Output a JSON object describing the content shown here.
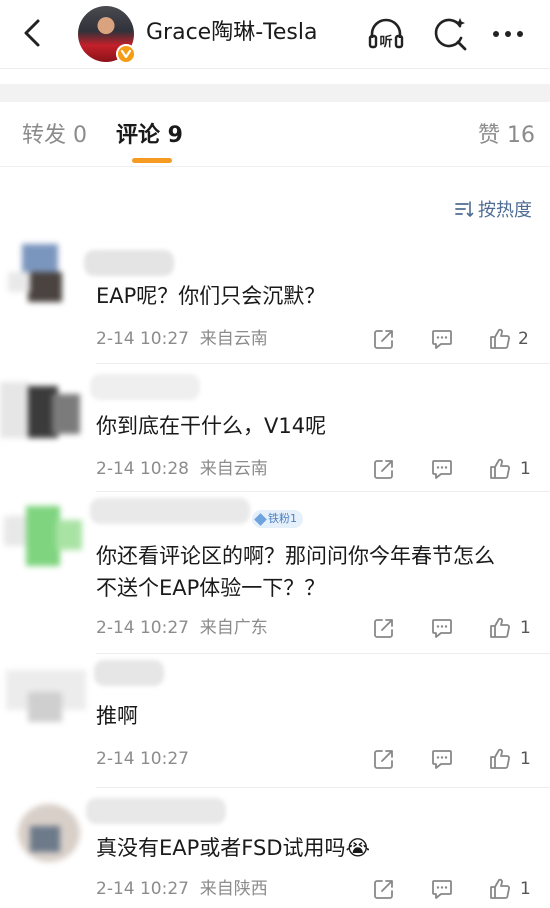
{
  "header": {
    "title": "Grace陶琳-Tesla",
    "icons": [
      "back-arrow-icon",
      "listen-icon",
      "search-icon",
      "more-icon"
    ],
    "listen_label": "听"
  },
  "tabs": {
    "repost": "转发 0",
    "comment": "评论 9",
    "like": "赞 16"
  },
  "sort_label": "按热度",
  "accent_color": "#f59b22",
  "link_color": "#4f6d93",
  "comments": [
    {
      "text": "EAP呢？你们只会沉默？",
      "time": "2-14 10:27",
      "location": "来自云南",
      "likes": "2"
    },
    {
      "text": "你到底在干什么，V14呢",
      "time": "2-14 10:28",
      "location": "来自云南",
      "likes": "1"
    },
    {
      "text_line1": "你还看评论区的啊？那问问你今年春节怎么",
      "text_line2": "不送个EAP体验一下？？",
      "time": "2-14 10:27",
      "location": "来自广东",
      "likes": "1",
      "badge": "铁粉1"
    },
    {
      "text": "推啊",
      "time": "2-14 10:27",
      "location": "",
      "likes": "1"
    },
    {
      "text": "真没有EAP或者FSD试用吗😭",
      "time": "2-14 10:27",
      "location": "来自陕西",
      "likes": "1"
    }
  ]
}
